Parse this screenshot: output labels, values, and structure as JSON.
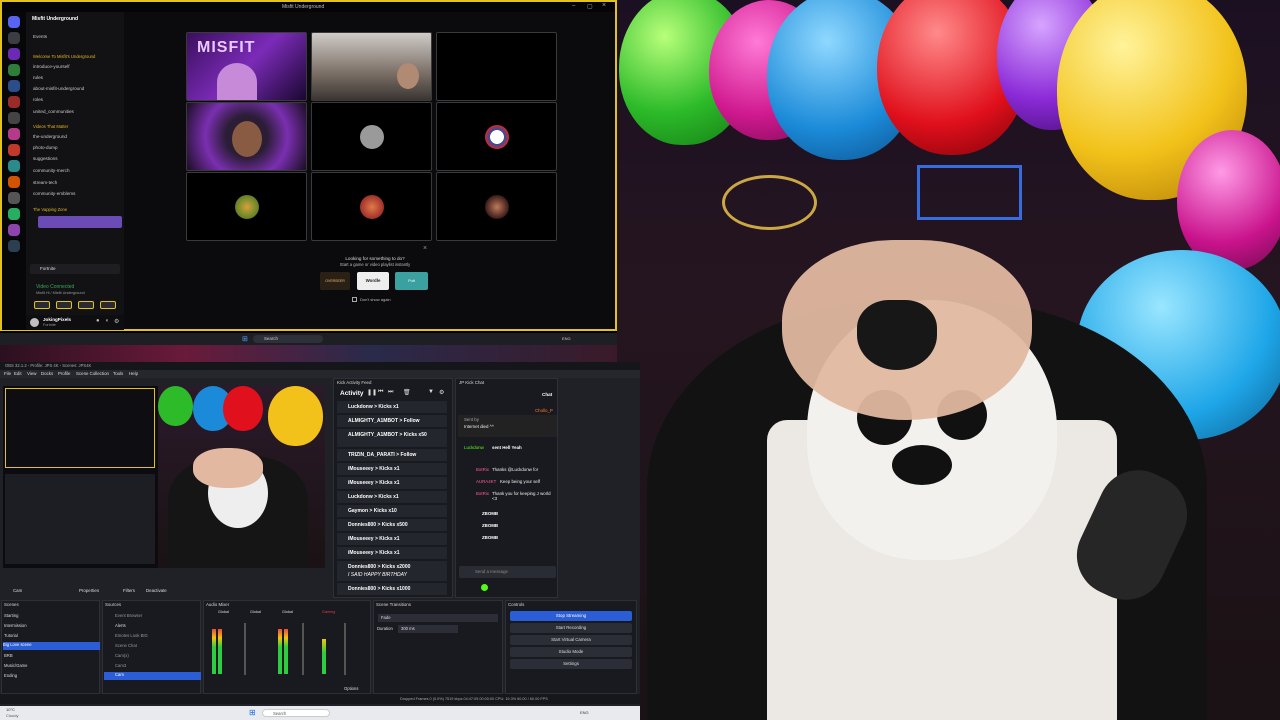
{
  "discord": {
    "window_title": "Misfit Underground",
    "server_name": "Misfit Underground",
    "channels": [
      {
        "label": "Events",
        "type": "item"
      },
      {
        "label": "Welcome To Misfit's Underground",
        "type": "cat"
      },
      {
        "label": "introduce-yourself",
        "type": "item"
      },
      {
        "label": "rules",
        "type": "item"
      },
      {
        "label": "about-misfit-underground",
        "type": "item"
      },
      {
        "label": "roles",
        "type": "item"
      },
      {
        "label": "united_communities",
        "type": "item"
      },
      {
        "label": "Videos That Matter",
        "type": "cat"
      },
      {
        "label": "the-underground",
        "type": "item"
      },
      {
        "label": "photo-dump",
        "type": "item"
      },
      {
        "label": "suggestions",
        "type": "item"
      },
      {
        "label": "community-merch",
        "type": "item"
      },
      {
        "label": "stream-tech",
        "type": "item"
      },
      {
        "label": "community-emblems",
        "type": "item"
      },
      {
        "label": "The Vapping Zone",
        "type": "cat"
      }
    ],
    "voice_label": "Fortnite",
    "status": "Video Connected",
    "status_sub": "Misfit Hi / Misfit Underground",
    "user_name": "JokingPixels",
    "user_sub": "Fortnite",
    "grid_brand": "MISFIT",
    "activity_prompt": "Looking for something to do?",
    "activity_sub": "Start a game or video playlist instantly",
    "activity_games": [
      "OVERSEER",
      "Wordle",
      "Putt"
    ],
    "dont_show": "Don't show again"
  },
  "taskbar_top": {
    "search": "Search",
    "time": "ENG"
  },
  "obs": {
    "title": "OBS 32.1.2 - Profile: JPS 4K - Scenes: JPS4K",
    "menu": [
      "File",
      "Edit",
      "View",
      "Docks",
      "Profile",
      "Scene Collection",
      "Tools",
      "Help"
    ],
    "kick_feed_title": "Kick Activity Feed",
    "kick_chat_title": "JP Kick Chat",
    "activity_label": "Activity",
    "feed": [
      {
        "text": "Luckdonw > Kicks x1",
        "time": "6m"
      },
      {
        "text": "ALMIGHTY_A1MBOT > Follow",
        "time": "14m"
      },
      {
        "text": "ALMIGHTY_A1MBOT > Kicks x50",
        "time": "14m"
      },
      {
        "text": "TRIZIN_DA_PARATI > Follow",
        "time": "14m"
      },
      {
        "text": "iMouseeey > Kicks x1",
        "time": "32m"
      },
      {
        "text": "iMouseeey > Kicks x1",
        "time": "32m"
      },
      {
        "text": "Luckdonw > Kicks x1",
        "time": "32m"
      },
      {
        "text": "Gaymon > Kicks x10",
        "time": "32m"
      },
      {
        "text": "Donnies800 > Kicks x500",
        "time": "32m"
      },
      {
        "text": "iMouseeey > Kicks x1",
        "time": "32m"
      },
      {
        "text": "iMouseeey > Kicks x1",
        "time": "32m"
      },
      {
        "text": "Donnies800 > Kicks x2000",
        "time": "32m"
      },
      {
        "text": "I SAID HAPPY BIRTHDAY",
        "time": ""
      },
      {
        "text": "Donnies800 > Kicks x1000",
        "time": "32m"
      }
    ],
    "chat_header": "Chat",
    "chat": [
      {
        "name": "Chollo_P",
        "text": ""
      },
      {
        "name": "Sent by",
        "text": "Internet died ^^"
      },
      {
        "name": "Luckdonw",
        "text": "sent Hell Yeah"
      },
      {
        "name": "BotRix",
        "text": "Thanks @Luckdonw for"
      },
      {
        "name": "AURA4KT",
        "text": "Keep being your self"
      },
      {
        "name": "BotRix",
        "text": "Thank you for keeping J world <3"
      },
      {
        "name": "ZBOMB",
        "text": ""
      },
      {
        "name": "ZBOMB",
        "text": ""
      },
      {
        "name": "ZBOMB",
        "text": ""
      }
    ],
    "chat_placeholder": "Send a message",
    "tabs": [
      "Cam",
      "Properties",
      "Filters",
      "Deactivate"
    ],
    "scenes_title": "Scenes",
    "scenes": [
      "Starting",
      "Intermission",
      "Tutorial",
      "Big Love scene",
      "BRB",
      "Music/Game",
      "Ending"
    ],
    "sources_title": "Sources",
    "sources": [
      "Event Browser",
      "Alerts",
      "Emotes Look BIG",
      "Scene Chat",
      "Cam(x)",
      "Cam3",
      "Cam"
    ],
    "mixer_title": "Audio Mixer",
    "mixer_channels": [
      "Global",
      "Global",
      "Global",
      "Gaming"
    ],
    "transitions_title": "Scene Transitions",
    "transition": "Fade",
    "duration_label": "Duration",
    "duration": "300 ms",
    "controls_title": "Controls",
    "controls": [
      "Stop Streaming",
      "Start Recording",
      "Start Virtual Camera",
      "Studio Mode",
      "Settings"
    ],
    "statusbar": "Dropped Frames 0 (0.0%)   7519 kbps   04:47:05   00:00:00   CPU: 19.3%   60.00 / 60.00 FPS",
    "options_label": "Options"
  },
  "taskbar_bottom": {
    "search": "Search",
    "temp": "10°C",
    "weather": "Cloudy",
    "lang": "ENG"
  },
  "colors": {
    "accent_yellow": "#e3c21c",
    "obs_blue": "#2b5dd6",
    "kick_green": "#53fc18"
  }
}
